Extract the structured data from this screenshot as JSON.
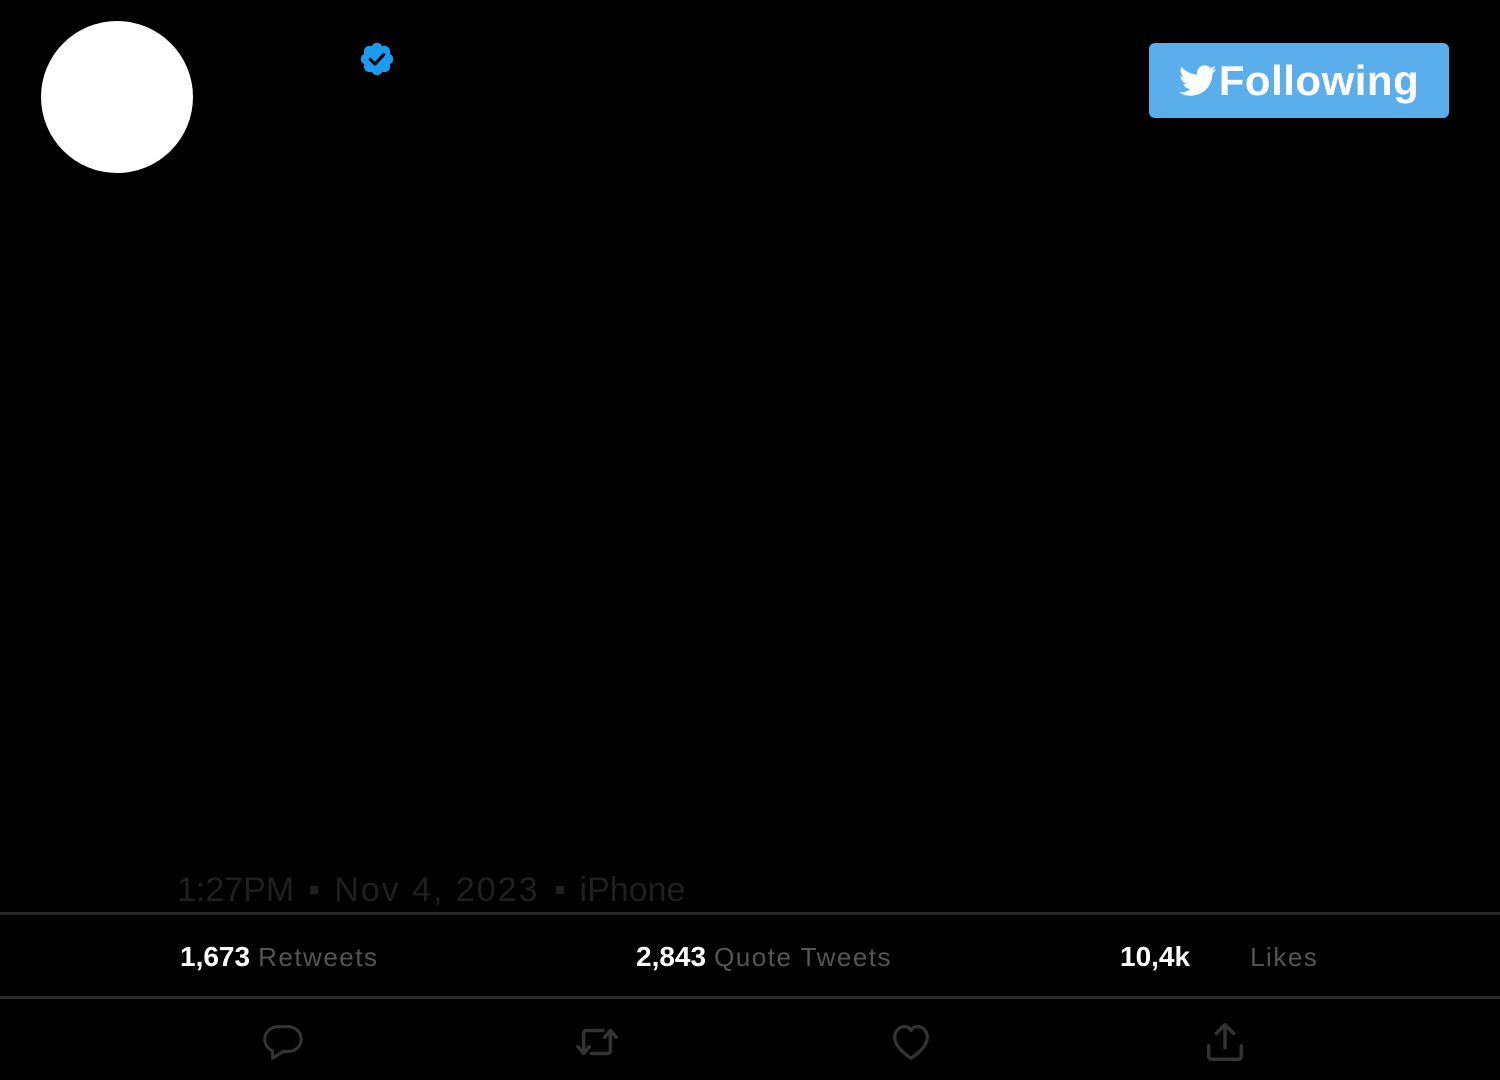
{
  "profile": {
    "avatar_color": "#ffffff",
    "verified_icon": "verified-badge-icon",
    "verified_color": "#1d9bf0"
  },
  "follow_button": {
    "label": "Following",
    "icon": "twitter-bird-icon",
    "background": "#5aaeeb"
  },
  "tweet_meta": {
    "time": "1:27PM",
    "date": "Nov 4, 2023",
    "source": "iPhone"
  },
  "stats": {
    "retweets": {
      "count": "1,673",
      "label": "Retweets"
    },
    "quote_tweets": {
      "count": "2,843",
      "label": "Quote Tweets"
    },
    "likes": {
      "count": "10,4k",
      "label": "Likes"
    }
  },
  "actions": [
    {
      "name": "reply",
      "icon": "reply-icon"
    },
    {
      "name": "retweet",
      "icon": "retweet-icon"
    },
    {
      "name": "like",
      "icon": "heart-icon"
    },
    {
      "name": "share",
      "icon": "share-icon"
    }
  ]
}
